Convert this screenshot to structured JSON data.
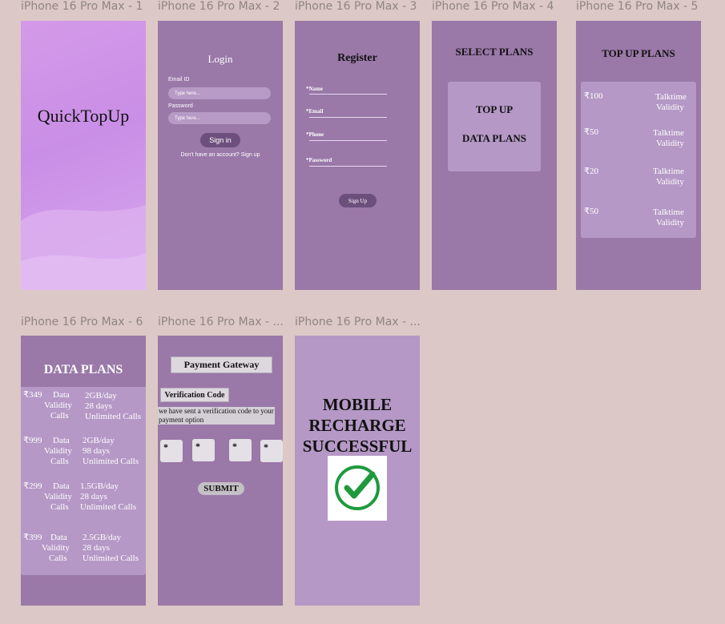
{
  "frames": {
    "f1": {
      "label": "iPhone 16 Pro Max - 1",
      "app_name": "QuickTopUp"
    },
    "f2": {
      "label": "iPhone 16 Pro Max - 2",
      "title": "Login",
      "email_label": "Email ID",
      "email_placeholder": "Type here...",
      "password_label": "Password",
      "password_placeholder": "Type here...",
      "sign_in": "Sign in",
      "signup_text": "Don't have an account? Sign up"
    },
    "f3": {
      "label": "iPhone 16 Pro Max - 3",
      "title": "Register",
      "name_label": "*Name",
      "email_label": "*Email",
      "phone_label": "*Phone",
      "password_label": "*Password",
      "sign_up": "Sign Up"
    },
    "f4": {
      "label": "iPhone 16 Pro Max - 4",
      "title": "SELECT PLANS",
      "top_up": "TOP UP",
      "data_plans": "DATA PLANS"
    },
    "f5": {
      "label": "iPhone 16 Pro Max - 5",
      "title": "TOP UP PLANS",
      "plans": [
        {
          "price": "₹100",
          "l1": "Talktime",
          "l2": "Validity"
        },
        {
          "price": "₹50",
          "l1": "Talktime",
          "l2": "Validity"
        },
        {
          "price": "₹20",
          "l1": "Talktime",
          "l2": "Validity"
        },
        {
          "price": "₹50",
          "l1": "Talktime",
          "l2": "Validity"
        }
      ]
    },
    "f6": {
      "label": "iPhone 16 Pro Max - 6",
      "title": "DATA PLANS",
      "plans": [
        {
          "price": "₹349",
          "k1": "Data",
          "k2": "Validity",
          "k3": "Calls",
          "v1": "2GB/day",
          "v2": "28 days",
          "v3": "Unlimited Calls"
        },
        {
          "price": "₹999",
          "k1": "Data",
          "k2": "Validity",
          "k3": "Calls",
          "v1": "2GB/day",
          "v2": "98 days",
          "v3": "Unlimited Calls"
        },
        {
          "price": "₹299",
          "k1": "Data",
          "k2": "Validity",
          "k3": "Calls",
          "v1": "1.5GB/day",
          "v2": "28 days",
          "v3": "Unlimited Calls"
        },
        {
          "price": "₹399",
          "k1": "Data",
          "k2": "Validity",
          "k3": "Calls",
          "v1": "2.5GB/day",
          "v2": "28 days",
          "v3": "Unlimited Calls"
        }
      ]
    },
    "f7": {
      "label": "iPhone 16 Pro Max - ...",
      "gateway": "Payment Gateway",
      "verification": "Verification Code",
      "message": "we have sent a verification code to your payment option",
      "otp": [
        "*",
        "*",
        "*",
        "*"
      ],
      "submit": "SUBMIT"
    },
    "f8": {
      "label": "iPhone 16 Pro Max - ...",
      "line1": "MOBILE",
      "line2": "RECHARGE",
      "line3": "SUCCESSFUL",
      "icon": "check-circle-icon",
      "icon_color": "#1e9a3c"
    }
  },
  "colors": {
    "canvas": "#dcc8c6",
    "frame": "#9a78a8",
    "panel": "#b598c6",
    "button": "#6d4f7d"
  }
}
